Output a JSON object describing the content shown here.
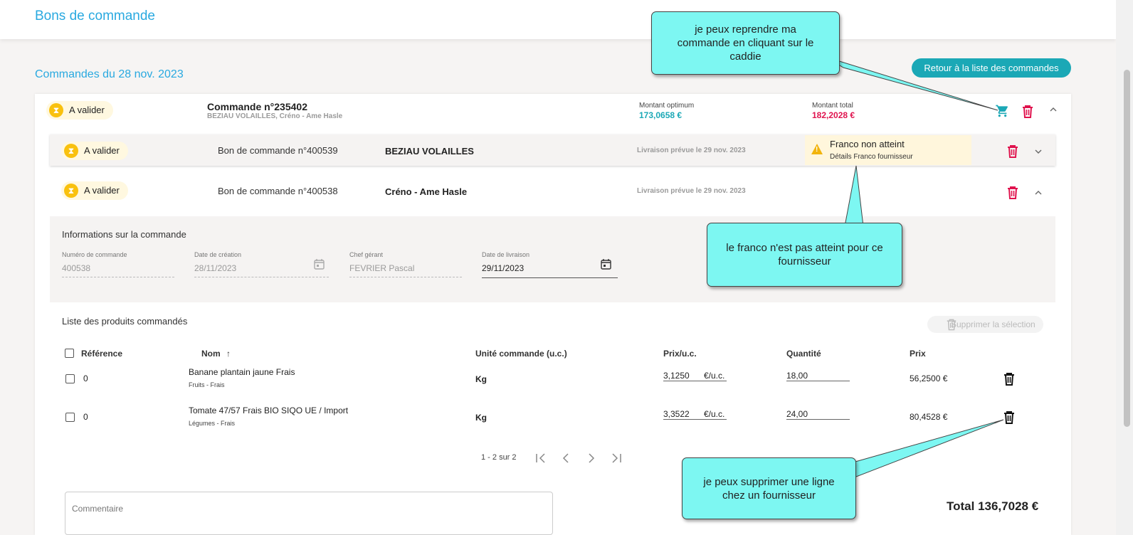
{
  "header": {
    "title": "Bons de commande"
  },
  "section": {
    "title": "Commandes du 28 nov. 2023",
    "back_button": "Retour à la liste des commandes"
  },
  "order": {
    "status": "A valider",
    "title": "Commande n°235402",
    "subtitle": "BEZIAU VOLAILLES, Créno - Ame Hasle",
    "optimum_label": "Montant optimum",
    "optimum_value": "173,0658 €",
    "total_label": "Montant total",
    "total_value": "182,2028 €",
    "icons": [
      "cart-icon",
      "trash-icon",
      "chevron-up-icon"
    ]
  },
  "sub_orders": [
    {
      "status": "A valider",
      "number": "Bon de commande n°400539",
      "supplier": "BEZIAU VOLAILLES",
      "delivery": "Livraison prévue le 29 nov. 2023",
      "franco_title": "Franco non atteint",
      "franco_link": "Détails Franco fournisseur"
    },
    {
      "status": "A valider",
      "number": "Bon de commande n°400538",
      "supplier": "Créno - Ame Hasle",
      "delivery": "Livraison prévue le 29 nov. 2023"
    }
  ],
  "info": {
    "title": "Informations sur la commande",
    "fields": [
      {
        "label": "Numéro de commande",
        "value": "400538"
      },
      {
        "label": "Date de création",
        "value": "28/11/2023"
      },
      {
        "label": "Chef gérant",
        "value": "FEVRIER Pascal"
      },
      {
        "label": "Date de livraison",
        "value": "29/11/2023"
      }
    ]
  },
  "products": {
    "title": "Liste des produits commandés",
    "delete_selection": "Supprimer la sélection",
    "columns": [
      "Référence",
      "Nom",
      "Unité commande (u.c.)",
      "Prix/u.c.",
      "Quantité",
      "Prix"
    ],
    "sort_indicator": "↑",
    "rows": [
      {
        "ref": "0",
        "name": "Banane plantain jaune Frais",
        "category": "Fruits - Frais",
        "unit": "Kg",
        "unit_price": "3,1250",
        "price_unit": "€/u.c.",
        "quantity": "18,00",
        "price": "56,2500 €"
      },
      {
        "ref": "0",
        "name": "Tomate 47/57 Frais BIO SIQO UE / Import",
        "category": "Légumes - Frais",
        "unit": "Kg",
        "unit_price": "3,3522",
        "price_unit": "€/u.c.",
        "quantity": "24,00",
        "price": "80,4528 €"
      }
    ],
    "pagination": "1 - 2 sur 2"
  },
  "comment_placeholder": "Commentaire",
  "total": "Total 136,7028 €",
  "callouts": {
    "cart": "je peux reprendre ma commande en cliquant sur le caddie",
    "franco": "le franco n'est pas atteint pour ce fournisseur",
    "delete": "je peux supprimer une ligne chez un fournisseur"
  },
  "colors": {
    "accent": "#29a9e0",
    "teal": "#1ba8b6",
    "danger": "#e0134e",
    "callout": "#7df7f2",
    "warning": "#f2b40c"
  }
}
